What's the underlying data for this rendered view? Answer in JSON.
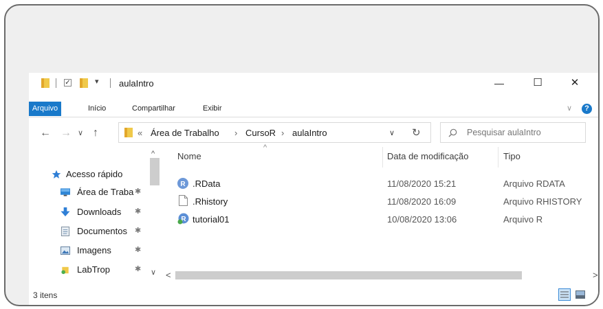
{
  "window": {
    "title": "aulaIntro"
  },
  "quick_access_toolbar": {
    "dropdown_glyph": "▾"
  },
  "window_controls": {
    "minimize": "—",
    "maximize": "☐",
    "close": "✕"
  },
  "ribbon": {
    "tabs": [
      {
        "label": "Arquivo",
        "active": true
      },
      {
        "label": "Início"
      },
      {
        "label": "Compartilhar"
      },
      {
        "label": "Exibir"
      }
    ],
    "expand_glyph": "∨",
    "help_label": "?"
  },
  "address_bar": {
    "back": "←",
    "forward": "→",
    "recent": "∨",
    "up": "↑",
    "overflow": "«",
    "breadcrumb": [
      "Área de Trabalho",
      "CursoR",
      "aulaIntro"
    ],
    "separator": "›",
    "dropdown": "∨",
    "refresh": "↻"
  },
  "search": {
    "placeholder": "Pesquisar aulaIntro",
    "icon": "search-icon"
  },
  "navigation_pane": {
    "items": [
      {
        "label": "Acesso rápido",
        "icon": "star-icon",
        "pinned": false
      },
      {
        "label": "Área de Traba",
        "icon": "desktop-icon",
        "pinned": true
      },
      {
        "label": "Downloads",
        "icon": "download-icon",
        "pinned": true
      },
      {
        "label": "Documentos",
        "icon": "document-icon",
        "pinned": true
      },
      {
        "label": "Imagens",
        "icon": "image-icon",
        "pinned": true
      },
      {
        "label": "LabTrop",
        "icon": "folder-icon",
        "pinned": true
      }
    ],
    "pin_glyph": "✱"
  },
  "file_list": {
    "sort_glyph": "^",
    "columns": [
      "Nome",
      "Data de modificação",
      "Tipo"
    ],
    "rows": [
      {
        "name": ".RData",
        "modified": "11/08/2020 15:21",
        "type": "Arquivo RDATA",
        "icon": "r-data-icon"
      },
      {
        "name": ".Rhistory",
        "modified": "11/08/2020 16:09",
        "type": "Arquivo RHISTORY",
        "icon": "blank-file-icon"
      },
      {
        "name": "tutorial01",
        "modified": "10/08/2020 13:06",
        "type": "Arquivo R",
        "icon": "r-script-icon"
      }
    ]
  },
  "scrollbars": {
    "up": "^",
    "down": "∨",
    "left": "<",
    "right": ">"
  },
  "status_bar": {
    "item_count": "3 itens"
  },
  "colors": {
    "accent": "#1979ca",
    "folder": "#f0c94a",
    "r_blue": "#5c8fd6"
  }
}
